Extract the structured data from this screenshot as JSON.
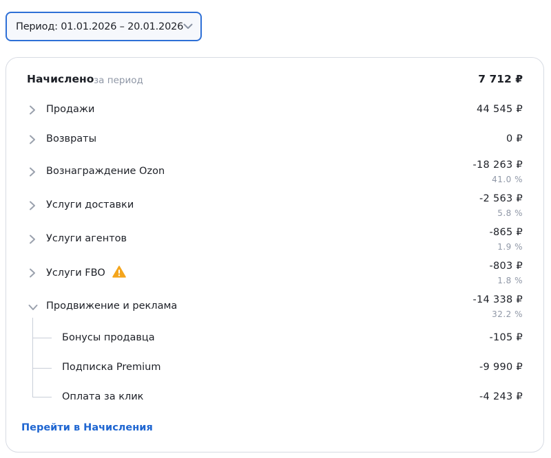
{
  "period": {
    "label": "Период: 01.01.2026 – 20.01.2026"
  },
  "summary": {
    "title": "Начислено",
    "subtitle": "за период",
    "total": "7 712 ₽"
  },
  "items": [
    {
      "name": "Продажи",
      "amount": "44 545 ₽",
      "percent": ""
    },
    {
      "name": "Возвраты",
      "amount": "0 ₽",
      "percent": ""
    },
    {
      "name": "Вознаграждение Ozon",
      "amount": "-18 263 ₽",
      "percent": "41.0 %"
    },
    {
      "name": "Услуги доставки",
      "amount": "-2 563 ₽",
      "percent": "5.8 %"
    },
    {
      "name": "Услуги агентов",
      "amount": "-865 ₽",
      "percent": "1.9 %"
    },
    {
      "name": "Услуги FBO",
      "amount": "-803 ₽",
      "percent": "1.8 %"
    },
    {
      "name": "Продвижение и реклама",
      "amount": "-14 338 ₽",
      "percent": "32.2 %"
    }
  ],
  "subitems": [
    {
      "name": "Бонусы продавца",
      "amount": "-105 ₽"
    },
    {
      "name": "Подписка Premium",
      "amount": "-9 990 ₽"
    },
    {
      "name": "Оплата за клик",
      "amount": "-4 243 ₽"
    }
  ],
  "footer": {
    "link_label": "Перейти в Начисления"
  },
  "icons": {
    "period_chevron": "chevron-down-icon",
    "row_chevron": "chevron-right-icon",
    "expanded_chevron": "chevron-down-icon",
    "warning": "warning-icon"
  },
  "colors": {
    "accent": "#2d6fd6",
    "link": "#1f66d1",
    "warning": "#f4a51c",
    "muted": "#8f97a6"
  }
}
